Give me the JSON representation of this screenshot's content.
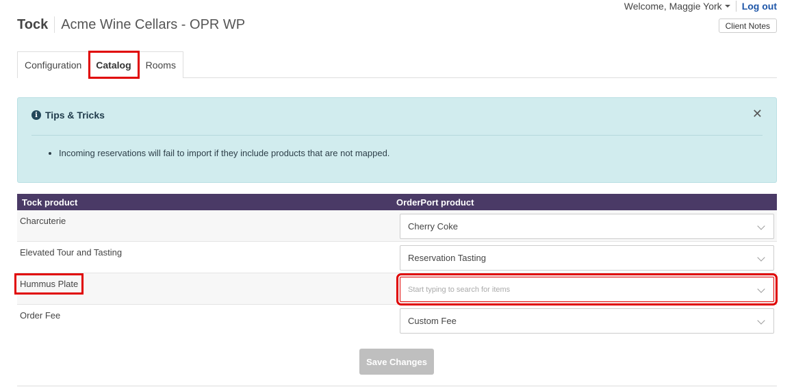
{
  "header": {
    "brand": "Tock",
    "subtitle": "Acme Wine Cellars - OPR WP",
    "welcome": "Welcome, Maggie York",
    "logout": "Log out",
    "client_notes": "Client Notes"
  },
  "tabs": [
    {
      "label": "Configuration",
      "active": false
    },
    {
      "label": "Catalog",
      "active": true
    },
    {
      "label": "Rooms",
      "active": false
    }
  ],
  "tips": {
    "title": "Tips & Tricks",
    "items": [
      "Incoming reservations will fail to import if they include products that are not mapped."
    ]
  },
  "catalog": {
    "col_tock": "Tock product",
    "col_orderport": "OrderPort product",
    "rows": [
      {
        "tock": "Charcuterie",
        "orderport": "Cherry Coke"
      },
      {
        "tock": "Elevated Tour and Tasting",
        "orderport": "Reservation Tasting"
      },
      {
        "tock": "Hummus Plate",
        "orderport": "",
        "placeholder": "Start typing to search for items"
      },
      {
        "tock": "Order Fee",
        "orderport": "Custom Fee"
      }
    ]
  },
  "save_label": "Save Changes",
  "colors": {
    "header_bg": "#4a3a66",
    "tips_bg": "#d1ecee",
    "highlight": "#e00000",
    "link": "#1e56a8"
  }
}
